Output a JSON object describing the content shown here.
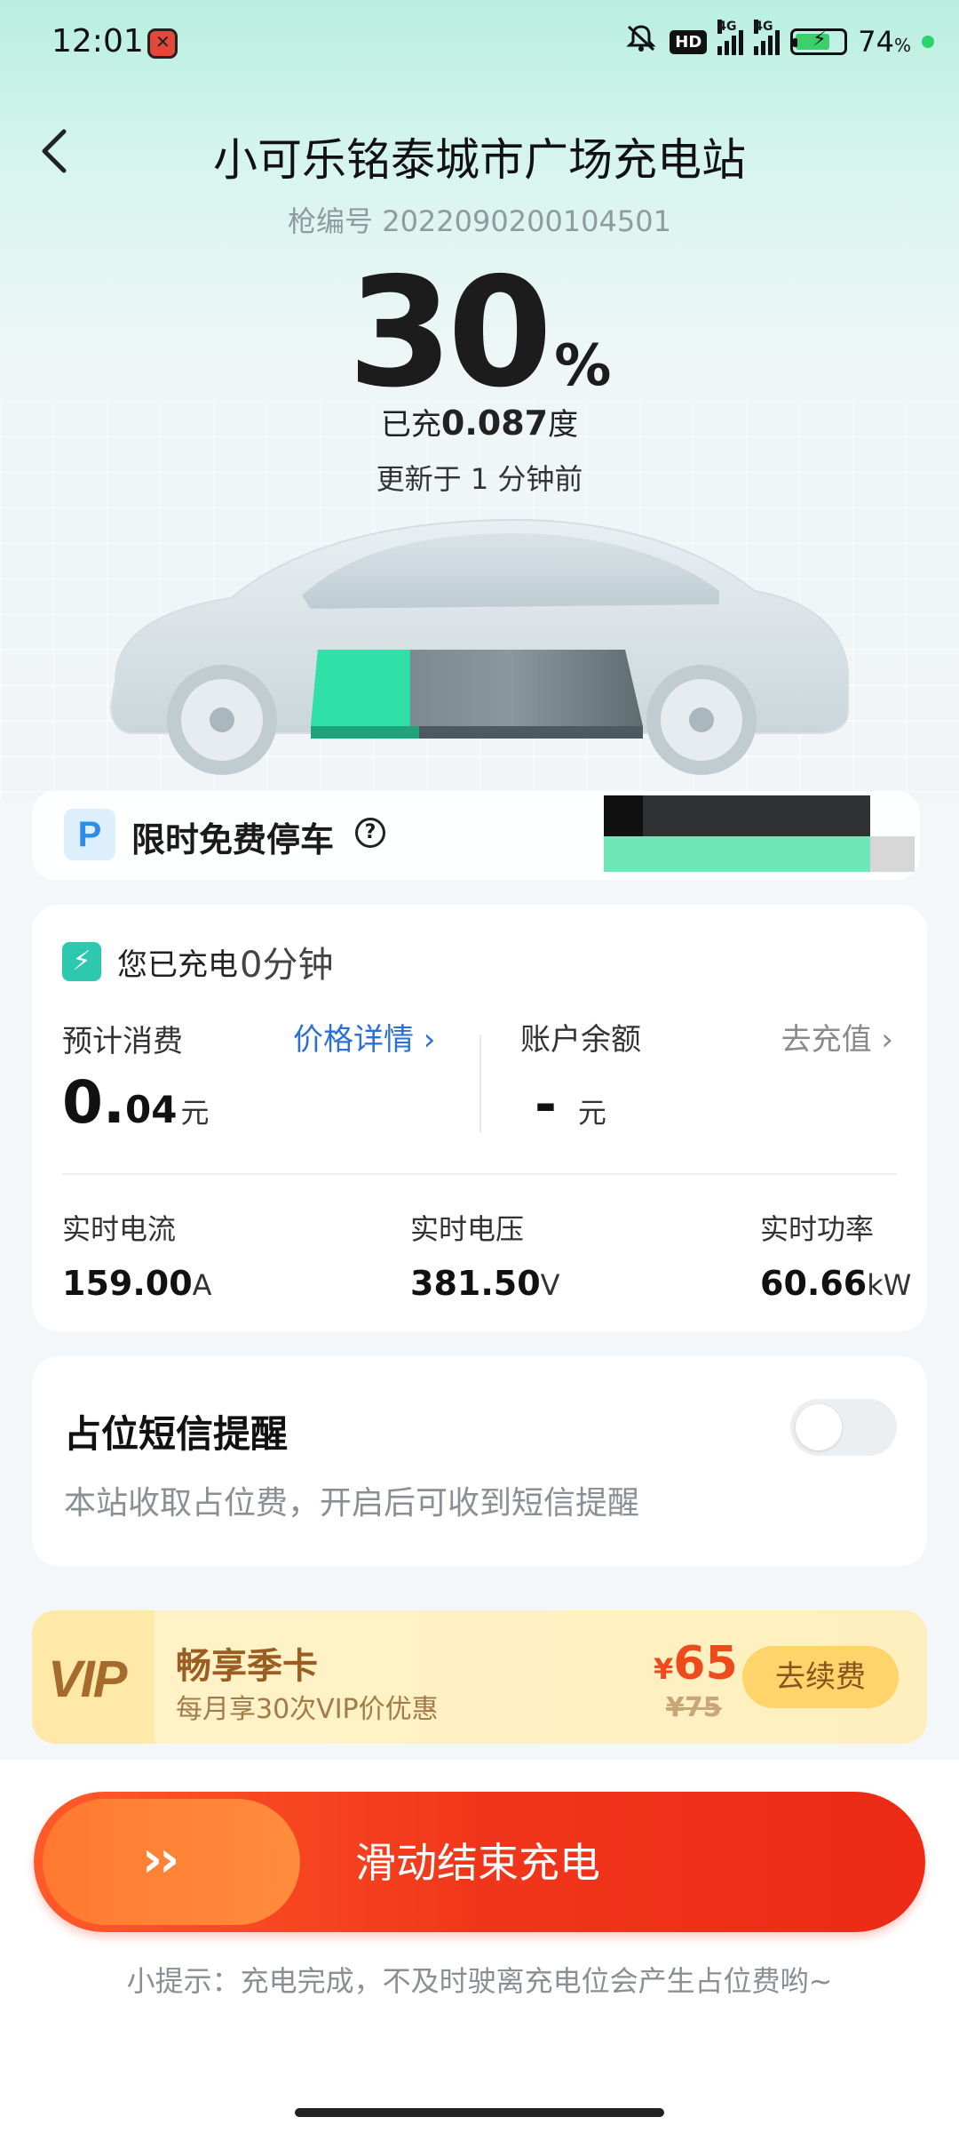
{
  "status_bar": {
    "time": "12:01",
    "hd": "HD",
    "net1": "4G",
    "net2": "4G",
    "battery_pct": "74",
    "battery_unit": "%"
  },
  "header": {
    "title": "小可乐铭泰城市广场充电站",
    "gun_id": "枪编号 2022090200104501"
  },
  "charge_status": {
    "percent": "30",
    "percent_sign": "%",
    "charged_prefix": "已充",
    "charged_value": "0.087",
    "charged_unit": "度",
    "updated": "更新于 1 分钟前",
    "battery_level": 0.3
  },
  "parking": {
    "icon_letter": "P",
    "label": "限时免费停车",
    "help": "?"
  },
  "charge_card": {
    "duration_label": "您已充电",
    "duration_value": "0分钟",
    "est_label": "预计消费",
    "price_detail": "价格详情 ›",
    "est_int": "0.",
    "est_dec": "04",
    "est_unit": "元",
    "balance_label": "账户余额",
    "recharge": "去充值 ›",
    "balance_value": "-",
    "balance_unit": "元",
    "metrics": [
      {
        "label": "实时电流",
        "value": "159.00",
        "unit": "A"
      },
      {
        "label": "实时电压",
        "value": "381.50",
        "unit": "V"
      },
      {
        "label": "实时功率",
        "value": "60.66",
        "unit": "kW"
      }
    ]
  },
  "sms": {
    "title": "占位短信提醒",
    "desc": "本站收取占位费，开启后可收到短信提醒",
    "enabled": false
  },
  "vip": {
    "logo": "VIP",
    "title": "畅享季卡",
    "subtitle": "每月享30次VIP价优惠",
    "currency": "¥",
    "price": "65",
    "original": "¥75",
    "button": "去续费"
  },
  "slider": {
    "arrows": "››",
    "label": "滑动结束充电"
  },
  "tip": "小提示：充电完成，不及时驶离充电位会产生占位费哟~",
  "colors": {
    "accent_blue": "#2b6fd8",
    "battery_green": "#2fe0a8",
    "end_red": "#ec2a16",
    "vip_brown": "#9a5d22"
  }
}
